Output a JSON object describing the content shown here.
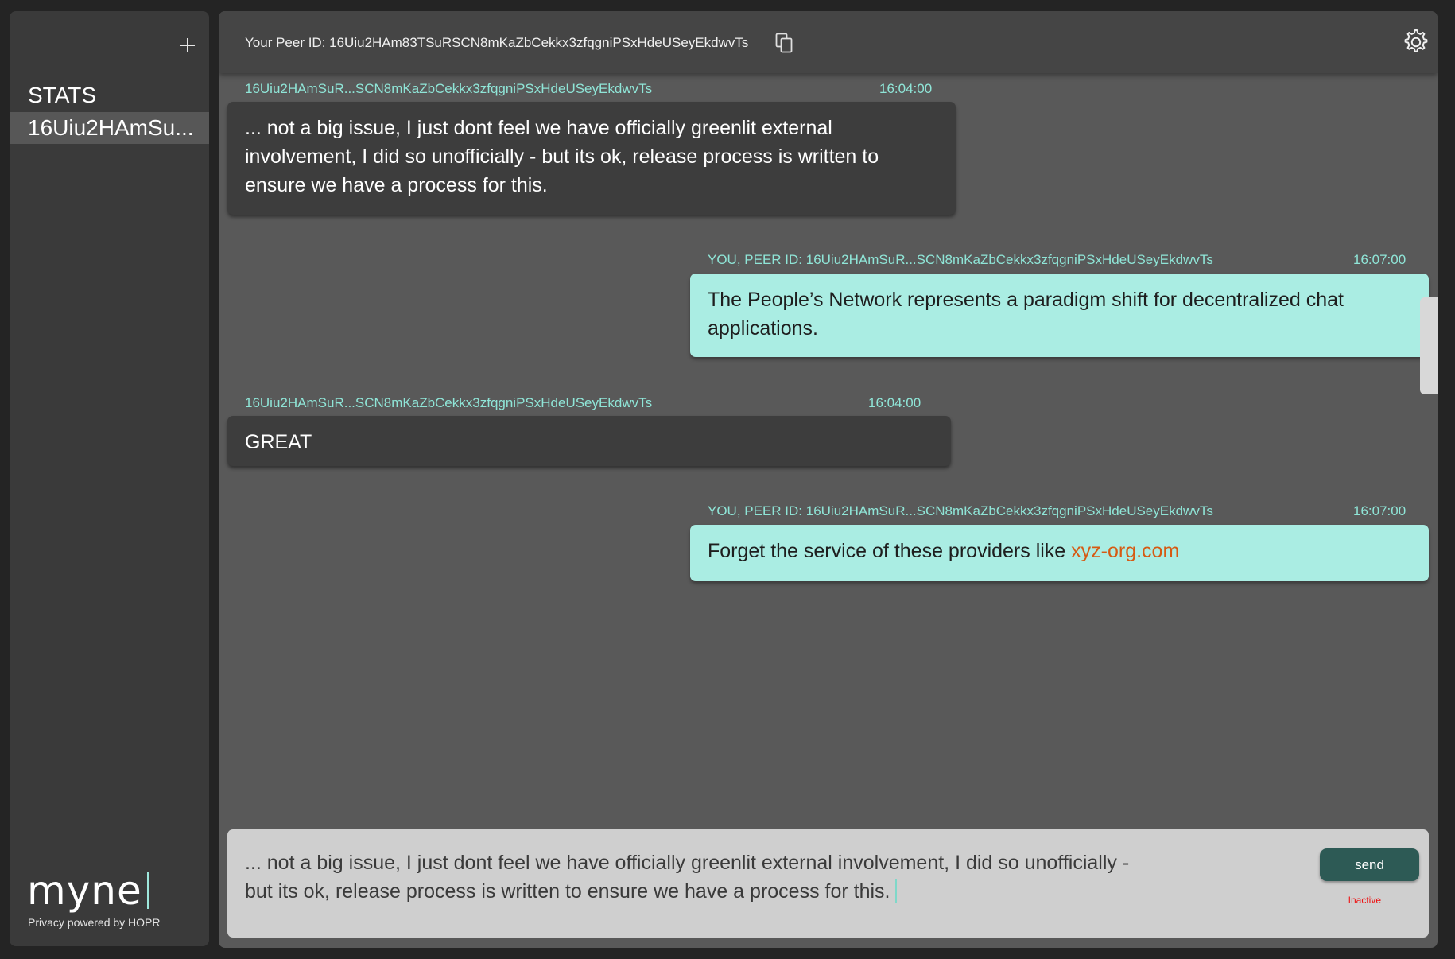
{
  "sidebar": {
    "add_icon": "plus-icon",
    "items": [
      {
        "label": "STATS"
      },
      {
        "label": "16Uiu2HAmSu..."
      }
    ],
    "brand": {
      "logo": "myne",
      "tagline": "Privacy powered by HOPR"
    }
  },
  "header": {
    "peer_id_label": "Your Peer ID: 16Uiu2HAm83TSuRSCN8mKaZbCekkx3zfqgniPSxHdeUSeyEkdwvTs",
    "copy_icon": "copy-icon",
    "settings_icon": "gear-icon"
  },
  "messages": [
    {
      "direction": "in",
      "sender": "16Uiu2HAmSuR...SCN8mKaZbCekkx3zfqgniPSxHdeUSeyEkdwvTs",
      "time": "16:04:00",
      "text": "... not a big issue, I just dont feel we have officially greenlit external involvement, I did so unofficially - but its ok, release process is written to ensure we have a process for this."
    },
    {
      "direction": "out",
      "sender": "YOU, PEER ID: 16Uiu2HAmSuR...SCN8mKaZbCekkx3zfqgniPSxHdeUSeyEkdwvTs",
      "time": "16:07:00",
      "text": "The People’s Network represents a paradigm shift for decentralized chat applications."
    },
    {
      "direction": "in",
      "sender": "16Uiu2HAmSuR...SCN8mKaZbCekkx3zfqgniPSxHdeUSeyEkdwvTs",
      "time": "16:04:00",
      "text": "GREAT"
    },
    {
      "direction": "out",
      "sender": "YOU, PEER ID: 16Uiu2HAmSuR...SCN8mKaZbCekkx3zfqgniPSxHdeUSeyEkdwvTs",
      "time": "16:07:00",
      "text_prefix": "Forget the service of these providers like ",
      "link": "xyz-org.com"
    }
  ],
  "composer": {
    "value": "... not a big issue, I just dont feel we have officially greenlit external involvement, I did so unofficially - but its ok, release process is written to ensure we have a process for this.",
    "send_label": "send",
    "status": "Inactive"
  },
  "colors": {
    "accent": "#8fe5d7",
    "outgoing_bubble": "#aaede3",
    "incoming_bubble": "#3d3d3d",
    "send_button": "#2d5a55",
    "status_inactive": "#ee1111",
    "link": "#d65a12"
  }
}
